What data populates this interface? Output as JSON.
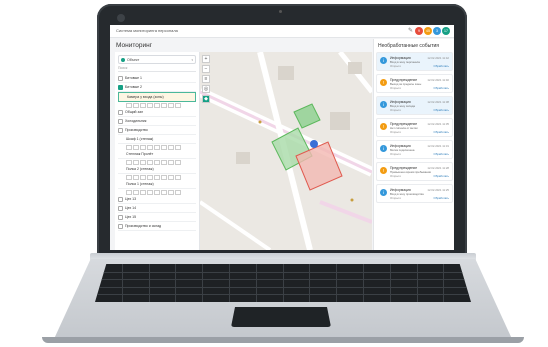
{
  "app": {
    "title": "Система мониторинга персонала",
    "page_title": "Мониторинг",
    "notifications": [
      "9",
      "45",
      "3",
      "17"
    ]
  },
  "left_panel": {
    "selected_object": "Объект",
    "search_placeholder": "Поиск",
    "items": [
      {
        "label": "Битовые 1",
        "selected": false
      },
      {
        "label": "Битовые 2",
        "selected": false
      },
      {
        "label": "Камера у входа (зоны)",
        "selected": true
      },
      {
        "label": "Общий зал",
        "selected": false
      },
      {
        "label": "Холодильник",
        "selected": false
      },
      {
        "label": "Производство",
        "selected": false
      },
      {
        "label": "Шкаф 1 (стелаж)",
        "selected": false
      },
      {
        "label": "Стеллаж Пролёт",
        "selected": false
      },
      {
        "label": "Полка 2 (стелаж)",
        "selected": false
      },
      {
        "label": "Полка 1 (стелаж)",
        "selected": false
      },
      {
        "label": "Цех 13",
        "selected": false
      },
      {
        "label": "Цех 14",
        "selected": false
      },
      {
        "label": "Цех 15",
        "selected": false
      },
      {
        "label": "Производство и склад",
        "selected": false
      }
    ]
  },
  "map": {
    "zoom_in": "+",
    "zoom_out": "−",
    "layers": "≡",
    "locate": "◎"
  },
  "right_panel": {
    "title": "Необработанные события",
    "events": [
      {
        "type": "Информация",
        "time": "12.02.2021 11:42",
        "text": "Вход в зону персонала",
        "status": "Открыто",
        "action": "Обработать",
        "kind": "info"
      },
      {
        "type": "Предупреждение",
        "time": "12.02.2021 11:40",
        "text": "Выход за пределы зоны",
        "status": "Открыто",
        "action": "Обработать",
        "kind": "warn"
      },
      {
        "type": "Информация",
        "time": "12.02.2021 11:38",
        "text": "Вход в зону склада",
        "status": "Открыто",
        "action": "Обработать",
        "kind": "info"
      },
      {
        "type": "Предупреждение",
        "time": "12.02.2021 11:35",
        "text": "Нет сигнала от метки",
        "status": "Открыто",
        "action": "Обработать",
        "kind": "warn"
      },
      {
        "type": "Информация",
        "time": "12.02.2021 11:31",
        "text": "Метка подключена",
        "status": "Открыто",
        "action": "Обработать",
        "kind": "info"
      },
      {
        "type": "Предупреждение",
        "time": "12.02.2021 11:28",
        "text": "Превышено время пребывания",
        "status": "Открыто",
        "action": "Обработать",
        "kind": "warn"
      },
      {
        "type": "Информация",
        "time": "12.02.2021 11:25",
        "text": "Вход в зону производства",
        "status": "Открыто",
        "action": "Обработать",
        "kind": "info"
      }
    ]
  },
  "colors": {
    "accent": "#16a085",
    "zone_green": "#5cb85c",
    "zone_red": "#e05a4f",
    "marker": "#3b6fd6"
  }
}
